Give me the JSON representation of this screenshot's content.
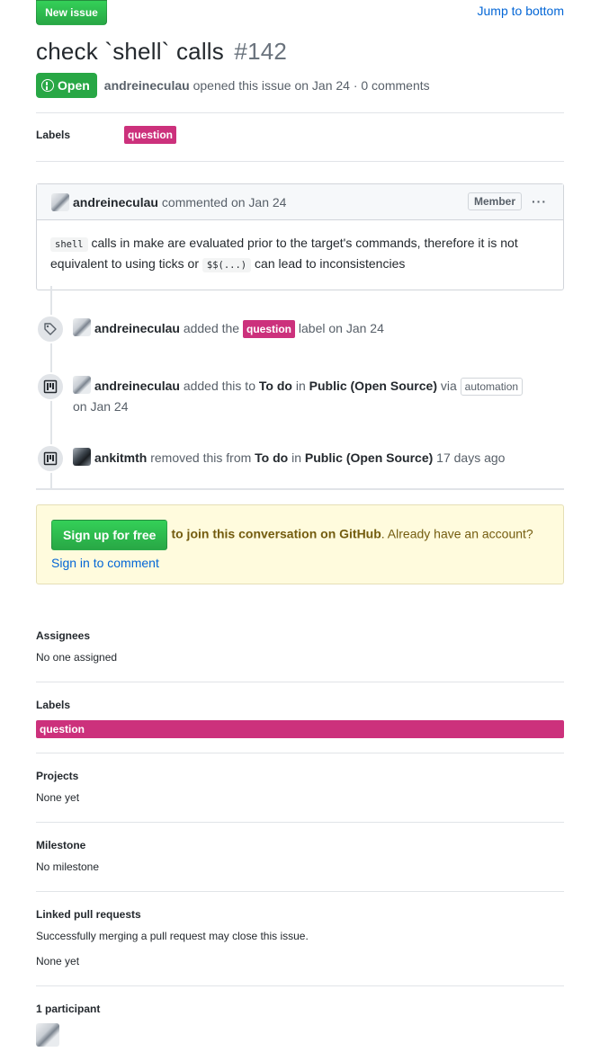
{
  "header": {
    "new_issue": "New issue",
    "jump_to_bottom": "Jump to bottom",
    "title": "check `shell` calls",
    "number": "#142",
    "state": "Open",
    "author": "andreineculau",
    "meta_rest": "opened this issue on Jan 24 · 0 comments"
  },
  "labels_row": {
    "key": "Labels",
    "label": "question"
  },
  "label_color": "#cc317c",
  "comment": {
    "author": "andreineculau",
    "when": "commented on Jan 24",
    "role": "Member",
    "menu": "···",
    "code1": "shell",
    "text1": "calls in make are evaluated prior to the target's commands, therefore it is not equivalent to using ticks or",
    "code2": "$$(...)",
    "text2": "can lead to inconsistencies"
  },
  "timeline": {
    "e1": {
      "user": "andreineculau",
      "t1": "added the",
      "label": "question",
      "t2": "label on Jan 24"
    },
    "e2": {
      "user": "andreineculau",
      "t1": "added this to",
      "col": "To do",
      "in": "in",
      "project": "Public (Open Source)",
      "via": "via",
      "auto": "automation",
      "when": "on Jan 24"
    },
    "e3": {
      "user": "ankitmth",
      "t1": "removed this from",
      "col": "To do",
      "in": "in",
      "project": "Public (Open Source)",
      "when": "17 days ago"
    }
  },
  "signup": {
    "button": "Sign up for free",
    "join": "to join this conversation on GitHub",
    "account": ". Already have an account?",
    "signin": "Sign in to comment"
  },
  "sidebar": {
    "assignees": {
      "key": "Assignees",
      "value": "No one assigned"
    },
    "labels": {
      "key": "Labels",
      "label": "question"
    },
    "projects": {
      "key": "Projects",
      "value": "None yet"
    },
    "milestone": {
      "key": "Milestone",
      "value": "No milestone"
    },
    "linked": {
      "key": "Linked pull requests",
      "note": "Successfully merging a pull request may close this issue.",
      "value": "None yet"
    },
    "participants": {
      "key": "1 participant"
    }
  }
}
